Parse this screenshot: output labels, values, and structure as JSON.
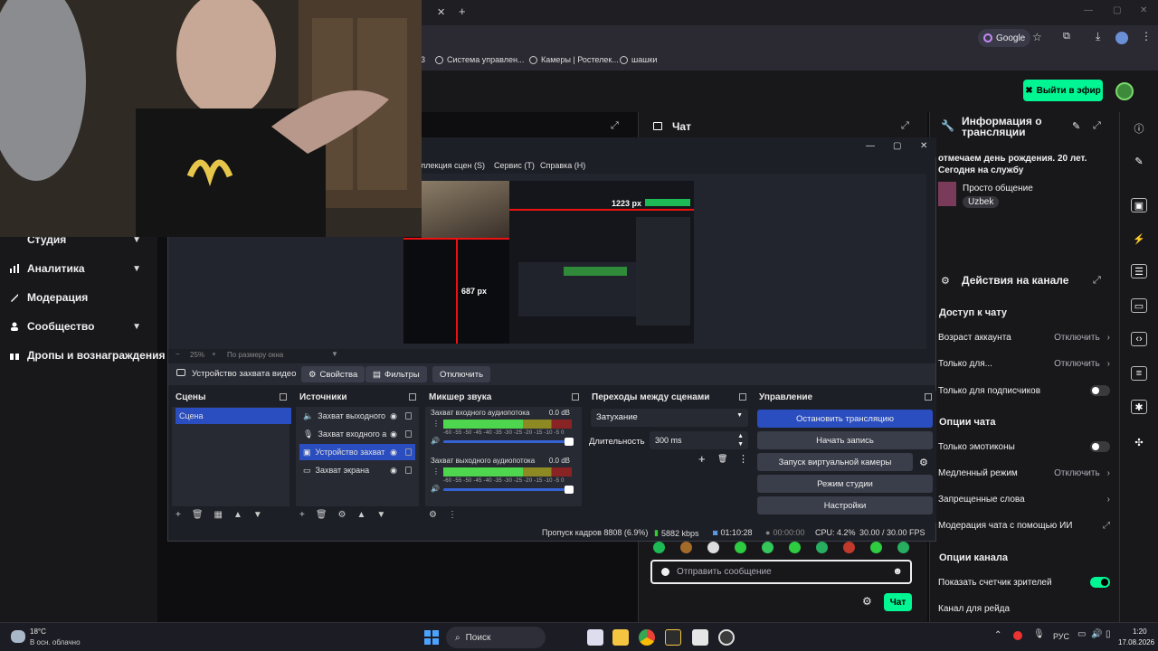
{
  "browser": {
    "search_engine": "Google",
    "bookmarks": [
      "Система управлен...",
      "Камеры | Ростелек...",
      "шашки"
    ],
    "bookmark_prefix": "3"
  },
  "twitch": {
    "go_live_label": "Выйти в эфир",
    "accent": "#00f593",
    "nav": [
      {
        "label": "Студия",
        "expandable": true
      },
      {
        "label": "Аналитика",
        "expandable": true
      },
      {
        "label": "Модерация",
        "expandable": false
      },
      {
        "label": "Сообщество",
        "expandable": true
      },
      {
        "label": "Дропы и вознаграждения",
        "expandable": false
      }
    ],
    "chat_title": "Чат",
    "chat_placeholder": "Отправить сообщение",
    "chat_send_label": "Чат",
    "stream_info": {
      "title": "Информация о трансляции",
      "stream_title": "отмечаем день рождения. 20 лет. Сегодня на службу",
      "category": "Просто общение",
      "tag": "Uzbek"
    },
    "channel_actions": {
      "title": "Действия на канале",
      "chat_access": "Доступ к чату",
      "account_age": {
        "label": "Возраст аккаунта",
        "value": "Отключить"
      },
      "followers_only": {
        "label": "Только для...",
        "value": "Отключить"
      },
      "subs_only": {
        "label": "Только для подписчиков",
        "on": false
      },
      "chat_options": "Опции чата",
      "emotes_only": {
        "label": "Только эмотиконы",
        "on": false
      },
      "slow_mode": {
        "label": "Медленный режим",
        "value": "Отключить"
      },
      "banned_words": "Запрещенные слова",
      "ai_moderation": "Модерация чата с помощью ИИ",
      "channel_options": "Опции канала",
      "viewer_count": {
        "label": "Показать счетчик зрителей",
        "on": true
      },
      "raid_channel": "Канал для рейда"
    }
  },
  "obs": {
    "menu": [
      "ллекция сцен (S)",
      "Сервис (T)",
      "Справка (H)"
    ],
    "preview_labels": {
      "width": "1223 px",
      "height": "687 px"
    },
    "zoom": {
      "level": "25%",
      "mode": "По размеру окна"
    },
    "source_toolbar": {
      "source_name": "Устройство захвата видео",
      "properties": "Свойства",
      "filters": "Фильтры",
      "deactivate": "Отключить"
    },
    "scenes": {
      "title": "Сцены",
      "items": [
        "Сцена"
      ]
    },
    "sources": {
      "title": "Источники",
      "items": [
        {
          "label": "Захват выходного",
          "icon": "speaker-icon"
        },
        {
          "label": "Захват входного а",
          "icon": "mic-icon"
        },
        {
          "label": "Устройство захват",
          "icon": "camera-icon",
          "selected": true
        },
        {
          "label": "Захват экрана",
          "icon": "monitor-icon"
        }
      ]
    },
    "mixer": {
      "title": "Микшер звука",
      "channels": [
        {
          "name": "Захват входного аудиопотока",
          "db": "0.0 dB"
        },
        {
          "name": "Захват выходного аудиопотока",
          "db": "0.0 dB"
        }
      ],
      "scale": "-60 -55 -50 -45 -40 -35 -30 -25 -20 -15 -10 -5 0"
    },
    "transitions": {
      "title": "Переходы между сценами",
      "selected": "Затухание",
      "duration_label": "Длительность",
      "duration_value": "300 ms"
    },
    "controls": {
      "title": "Управление",
      "buttons": [
        "Остановить трансляцию",
        "Начать запись",
        "Запуск виртуальной камеры",
        "Режим студии",
        "Настройки"
      ]
    },
    "status": {
      "dropped": "Пропуск кадров 8808 (6.9%)",
      "bitrate": "5882 kbps",
      "stream_time": "01:10:28",
      "rec_time": "00:00:00",
      "cpu": "CPU: 4.2%",
      "fps": "30.00 / 30.00 FPS"
    }
  },
  "taskbar": {
    "weather_temp": "18°C",
    "weather_desc": "В осн. облачно",
    "search_label": "Поиск",
    "language": "РУС",
    "time": "1:20",
    "date": "17.08.2026"
  }
}
